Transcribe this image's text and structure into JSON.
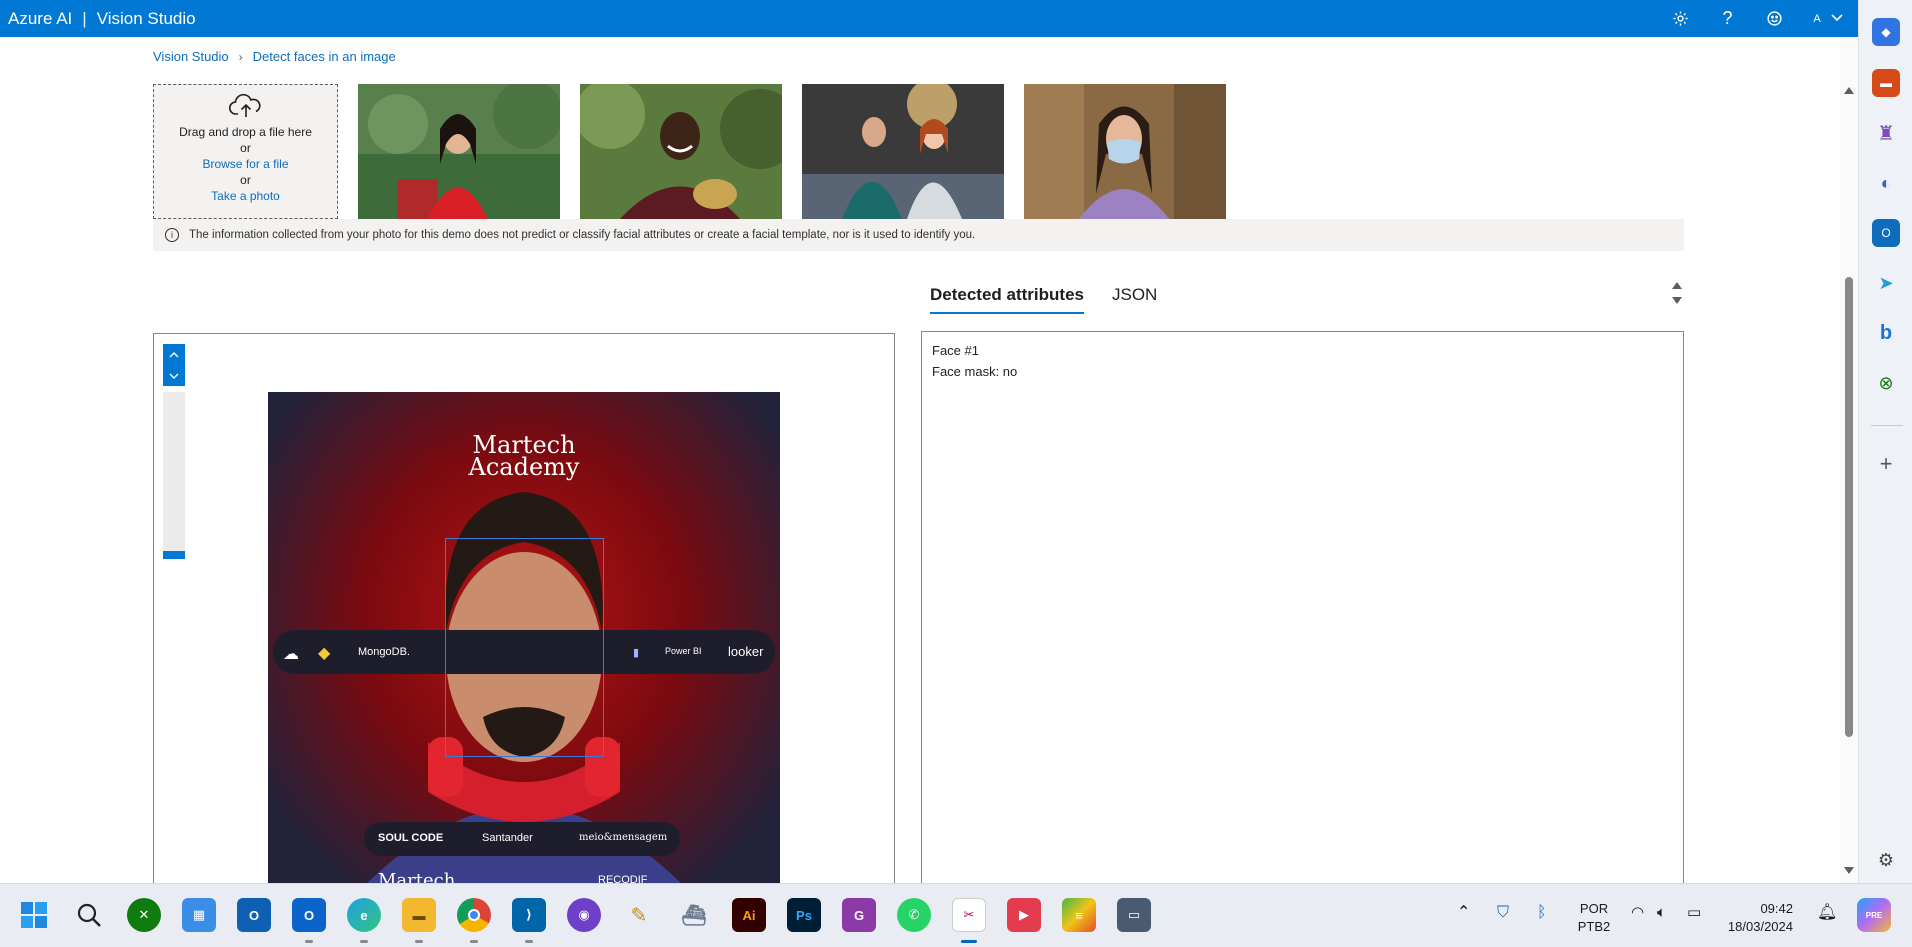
{
  "header": {
    "brand": "Azure AI",
    "separator": "|",
    "product": "Vision Studio",
    "account_initial": "A"
  },
  "breadcrumb": {
    "root": "Vision Studio",
    "current": "Detect faces in an image"
  },
  "upload": {
    "drag_text": "Drag and drop a file here",
    "or1": "or",
    "browse": "Browse for a file",
    "or2": "or",
    "take_photo": "Take a photo"
  },
  "info_notice": "The information collected from your photo for this demo does not predict or classify facial attributes or create a facial template, nor is it used to identify you.",
  "tabs": {
    "attributes": "Detected attributes",
    "json": "JSON"
  },
  "result_image": {
    "title_line1": "Martech",
    "title_line2": "Academy",
    "logos": [
      "MongoDB.",
      "Power BI",
      "looker"
    ],
    "sponsors": [
      "SOUL CODE",
      "Santander",
      "meio&mensagem"
    ],
    "shirt_text": "Martech",
    "shirt_text_right": "RECODIF"
  },
  "attributes": {
    "face_label": "Face #1",
    "mask_line": "Face mask: no"
  },
  "taskbar": {
    "lang_line1": "POR",
    "lang_line2": "PTB2",
    "time": "09:42",
    "date": "18/03/2024",
    "apps": [
      "Start",
      "Search",
      "Xbox",
      "Store",
      "Outlook",
      "Outlook New",
      "Edge",
      "File Explorer",
      "Chrome",
      "VS Code",
      "GitHub",
      "Pen",
      "Ship",
      "Illustrator",
      "Photoshop",
      "PDF",
      "WhatsApp",
      "Snipping Tool",
      "Clipchamp",
      "BlueStacks",
      "Terminal"
    ],
    "copilot_badge": "PRE"
  },
  "colors": {
    "accent": "#0078d4",
    "link": "#0f6cbd",
    "face_box": "#3a7bd5"
  }
}
